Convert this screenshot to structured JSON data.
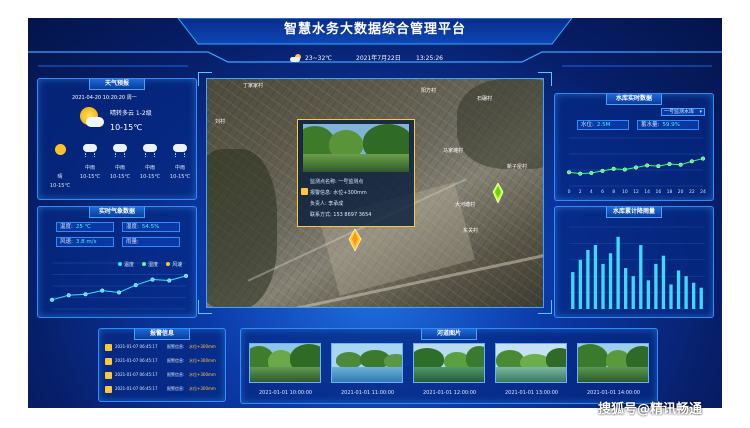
{
  "header": {
    "title": "智慧水务大数据综合管理平台",
    "temp_range": "23~32℃",
    "date": "2021年7月22日",
    "time": "13:25:26"
  },
  "weather": {
    "title": "天气预报",
    "datetime": "2021-04-20 10:20:20 周一",
    "condition": "晴转多云 1-2级",
    "temp": "10-15℃",
    "forecast": [
      {
        "label": "晴",
        "temp": "10-15℃"
      },
      {
        "label": "中雨",
        "temp": "10-15℃"
      },
      {
        "label": "中雨",
        "temp": "10-15℃"
      },
      {
        "label": "中雨",
        "temp": "10-15℃"
      },
      {
        "label": "中雨",
        "temp": "10-15℃"
      }
    ]
  },
  "meteo": {
    "title": "实时气象数据",
    "temp_label": "温度:",
    "temp_value": "25 ℃",
    "humidity_label": "湿度:",
    "humidity_value": "54.5%",
    "wind_label": "风速:",
    "wind_value": "3.8 m/s",
    "rain_label": "雨量:",
    "rain_value": "",
    "legend": [
      "温度",
      "湿度",
      "风速"
    ]
  },
  "alarms": {
    "title": "报警信息",
    "items": [
      {
        "time": "2021-01-07 06:45:17",
        "label": "报警信息:",
        "value": "水位+300mm"
      },
      {
        "time": "2021-01-07 06:45:17",
        "label": "报警信息:",
        "value": "水位+300mm"
      },
      {
        "time": "2021-01-07 06:45:17",
        "label": "报警信息:",
        "value": "水位+300mm"
      },
      {
        "time": "2021-01-07 06:45:17",
        "label": "报警信息:",
        "value": "水位+300mm"
      }
    ]
  },
  "map": {
    "villages": [
      "丁家家村",
      "阳方村",
      "石碾村",
      "刘村",
      "马家滩村",
      "新子屋村",
      "大河塘村",
      "东关村"
    ],
    "popup": {
      "name_label": "监测点名称:",
      "name_value": "一号监测点",
      "alarm_label": "报警信息:",
      "alarm_value": "水位+300mm",
      "person_label": "负责人:",
      "person_value": "李承成",
      "phone_label": "联系方式:",
      "phone_value": "153 8697 3654"
    }
  },
  "reservoir": {
    "title": "水库实时数据",
    "select": "一号监测水库",
    "level_label": "水位:",
    "level_value": "2.5M",
    "capacity_label": "蓄水量:",
    "capacity_value": "59.9%"
  },
  "rainfall": {
    "title": "水库累计降雨量"
  },
  "patrol": {
    "title": "河道图片",
    "photos": [
      {
        "date": "2021-01-01 10:00:00"
      },
      {
        "date": "2021-01-01 11:00:00"
      },
      {
        "date": "2021-01-01 12:00:00"
      },
      {
        "date": "2021-01-01 13:00:00"
      },
      {
        "date": "2021-01-01 14:00:00"
      }
    ]
  },
  "watermark": "搜狐号@精讯畅通",
  "chart_data": [
    {
      "type": "line",
      "series": [
        {
          "values": [
            1.0,
            1.5,
            1.6,
            2.0,
            1.8,
            2.6,
            3.2,
            3.1,
            3.6
          ]
        }
      ],
      "ylim": [
        0,
        5
      ]
    },
    {
      "type": "line",
      "x": [
        "0",
        "2",
        "4",
        "6",
        "8",
        "10",
        "12",
        "14",
        "16",
        "18",
        "20",
        "22",
        "24"
      ],
      "series": [
        {
          "values": [
            20,
            18,
            19,
            22,
            25,
            24,
            27,
            30,
            29,
            32,
            31,
            36,
            40
          ]
        }
      ],
      "ylim": [
        0,
        70
      ]
    },
    {
      "type": "bar",
      "series": [
        {
          "values": [
            45,
            60,
            72,
            78,
            55,
            68,
            88,
            50,
            40,
            78,
            35,
            55,
            65,
            30,
            47,
            40,
            32,
            26
          ]
        }
      ],
      "ylim": [
        0,
        100
      ]
    }
  ]
}
